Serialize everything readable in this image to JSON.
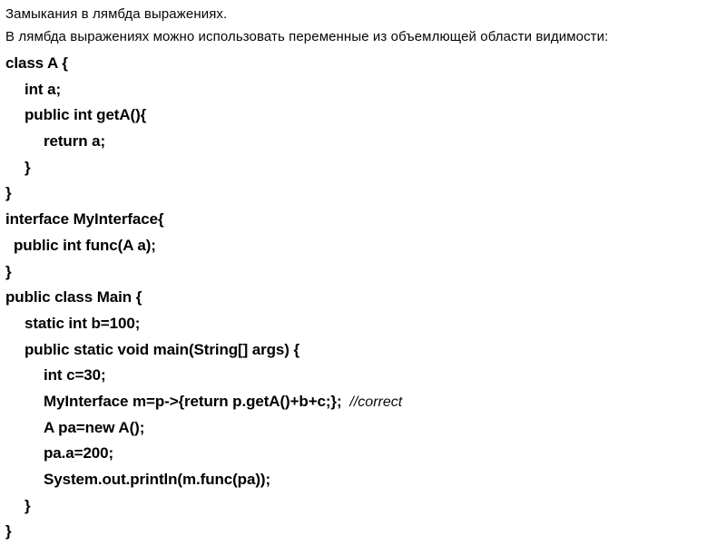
{
  "slide": {
    "background_color": "#ffffff",
    "text_color": "#000000",
    "title": "Замыкания в лямбда выражениях.",
    "subtitle": "В лямбда выражениях можно использовать переменные из объемлющей области видимости:"
  },
  "code": {
    "language": "java",
    "lines": [
      {
        "indent": 0,
        "text": "class A {"
      },
      {
        "indent": 1,
        "text": "int a;"
      },
      {
        "indent": 1,
        "text": "public int getA(){"
      },
      {
        "indent": 2,
        "text": "return a;"
      },
      {
        "indent": 1,
        "text": "}"
      },
      {
        "indent": 0,
        "text": "}"
      },
      {
        "indent": 0,
        "text": "interface MyInterface{"
      },
      {
        "indent": "half",
        "text": "public int func(A a);"
      },
      {
        "indent": 0,
        "text": "}"
      },
      {
        "indent": 0,
        "text": "public class Main {"
      },
      {
        "indent": 1,
        "text": "static int b=100;"
      },
      {
        "indent": 1,
        "text": "public static void main(String[] args) {"
      },
      {
        "indent": 2,
        "text": "int c=30;"
      },
      {
        "indent": 2,
        "text": "MyInterface m=p->{return p.getA()+b+c;};",
        "comment": "//correct"
      },
      {
        "indent": 2,
        "text": "A pa=new A();"
      },
      {
        "indent": 2,
        "text": "pa.a=200;"
      },
      {
        "indent": 2,
        "text": "System.out.println(m.func(pa));"
      },
      {
        "indent": 1,
        "text": "}"
      },
      {
        "indent": 0,
        "text": "}"
      }
    ]
  }
}
